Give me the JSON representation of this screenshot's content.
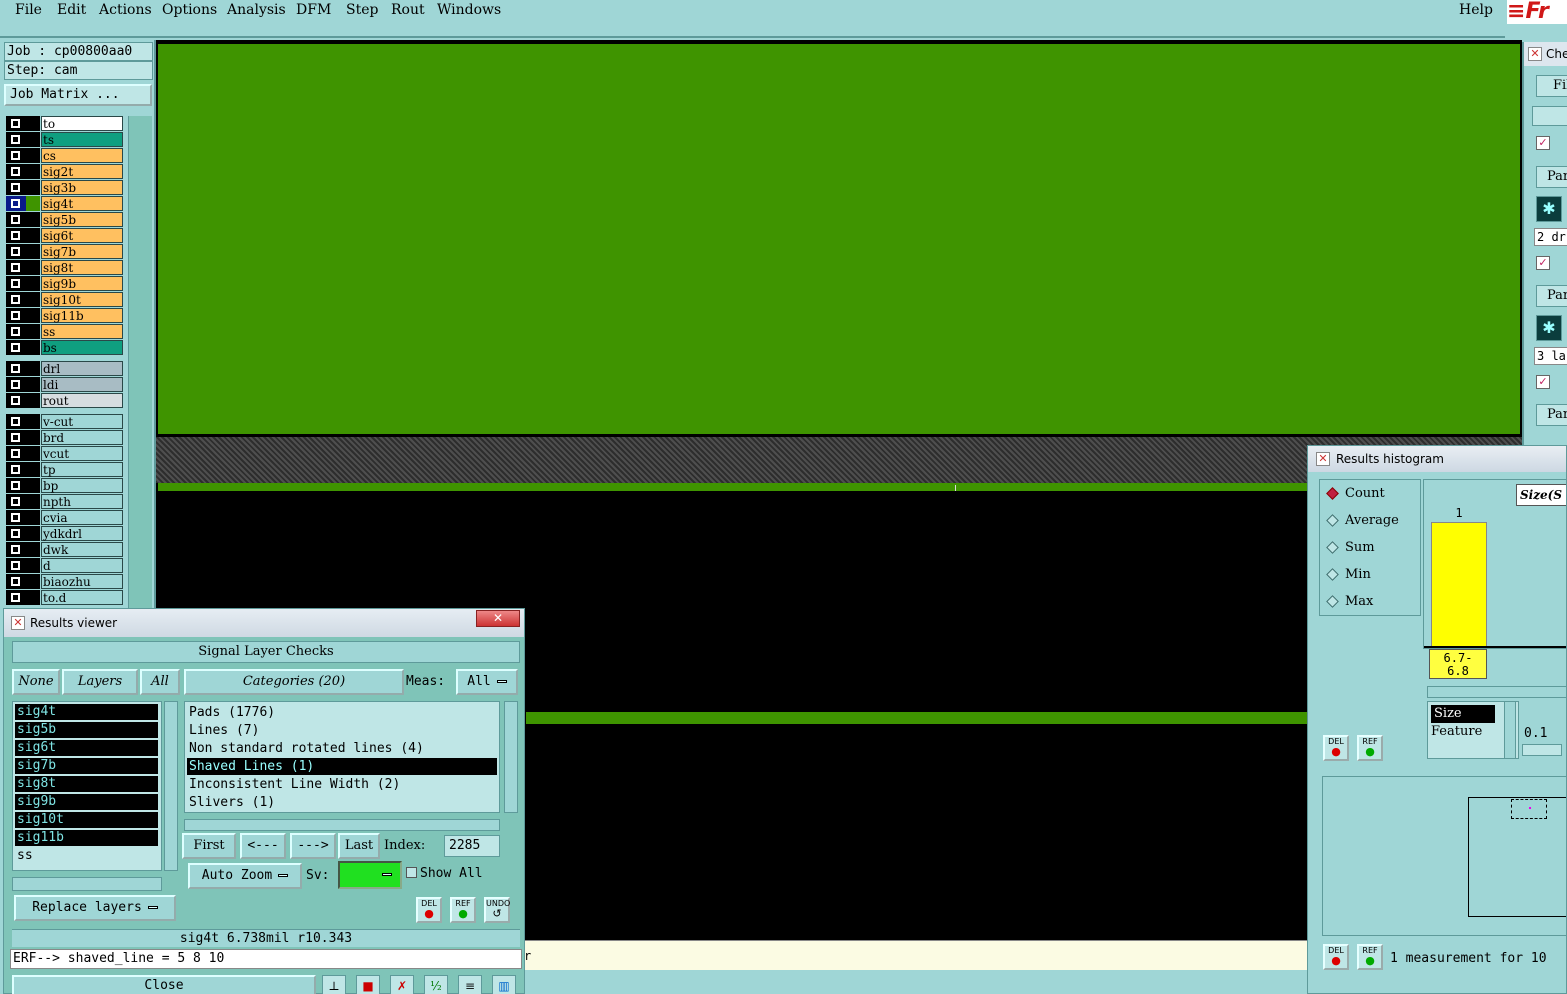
{
  "menu": {
    "items": [
      "File",
      "Edit",
      "Actions",
      "Options",
      "Analysis",
      "DFM",
      "Step",
      "Rout",
      "Windows"
    ],
    "help": "Help",
    "logo": "Fr"
  },
  "left_panel": {
    "job": "Job : cp00800aa0",
    "step": "Step: cam",
    "job_matrix": "Job Matrix ...",
    "layers": [
      {
        "name": "to",
        "color": "#ffffff"
      },
      {
        "name": "ts",
        "color": "#0f9f80"
      },
      {
        "name": "cs",
        "color": "#ffc060"
      },
      {
        "name": "sig2t",
        "color": "#ffc060"
      },
      {
        "name": "sig3b",
        "color": "#ffc060"
      },
      {
        "name": "sig4t",
        "color": "#ffc060"
      },
      {
        "name": "sig5b",
        "color": "#ffc060"
      },
      {
        "name": "sig6t",
        "color": "#ffc060"
      },
      {
        "name": "sig7b",
        "color": "#ffc060"
      },
      {
        "name": "sig8t",
        "color": "#ffc060"
      },
      {
        "name": "sig9b",
        "color": "#ffc060"
      },
      {
        "name": "sig10t",
        "color": "#ffc060"
      },
      {
        "name": "sig11b",
        "color": "#ffc060"
      },
      {
        "name": "ss",
        "color": "#ffc060"
      },
      {
        "name": "bs",
        "color": "#0f9f80"
      },
      {
        "name": "drl",
        "color": "#a8bcc4"
      },
      {
        "name": "ldi",
        "color": "#a8bcc4"
      },
      {
        "name": "rout",
        "color": "#d6dde0"
      },
      {
        "name": "v-cut",
        "color": "#9fd6d6"
      },
      {
        "name": "brd",
        "color": "#9fd6d6"
      },
      {
        "name": "vcut",
        "color": "#9fd6d6"
      },
      {
        "name": "tp",
        "color": "#9fd6d6"
      },
      {
        "name": "bp",
        "color": "#9fd6d6"
      },
      {
        "name": "npth",
        "color": "#9fd6d6"
      },
      {
        "name": "cvia",
        "color": "#9fd6d6"
      },
      {
        "name": "ydkdrl",
        "color": "#9fd6d6"
      },
      {
        "name": "dwk",
        "color": "#9fd6d6"
      },
      {
        "name": "d",
        "color": "#9fd6d6"
      },
      {
        "name": "biaozhu",
        "color": "#9fd6d6"
      },
      {
        "name": "to.d",
        "color": "#9fd6d6"
      }
    ],
    "active_layer": "sig4t"
  },
  "colors": {
    "canvas_bg": "#000000",
    "copper": "#3f9400",
    "panel": "#9fd6d6"
  },
  "status_bar": {
    "text": "r"
  },
  "right_window": {
    "title": "Che",
    "file_button": "File",
    "par_label": "Par",
    "entries": [
      "2 dr",
      "3 la"
    ]
  },
  "histogram": {
    "title": "Results histogram",
    "stats": [
      "Count",
      "Average",
      "Sum",
      "Min",
      "Max"
    ],
    "selected_stat": "Count",
    "size_combo": "Size(S",
    "bar_count": "1",
    "bar_label": "6.7-\n6.8",
    "list_items": [
      "Size",
      "Feature"
    ],
    "scale_value": "0.1",
    "del": "DEL",
    "ref": "REF",
    "measurement_text": "1 measurement for 10"
  },
  "results_viewer": {
    "title": "Results viewer",
    "heading": "Signal Layer Checks",
    "none_btn": "None",
    "layers_btn": "Layers",
    "all_btn": "All",
    "categories_btn": "Categories (20)",
    "meas_label": "Meas:",
    "meas_value": "All",
    "layer_items": [
      {
        "name": "sig4t",
        "selected": true
      },
      {
        "name": "sig5b",
        "selected": true
      },
      {
        "name": "sig6t",
        "selected": true
      },
      {
        "name": "sig7b",
        "selected": true
      },
      {
        "name": "sig8t",
        "selected": true
      },
      {
        "name": "sig9b",
        "selected": true
      },
      {
        "name": "sig10t",
        "selected": true
      },
      {
        "name": "sig11b",
        "selected": true
      },
      {
        "name": "ss",
        "selected": false
      }
    ],
    "categories": [
      {
        "name": "Pads (1776)",
        "selected": false
      },
      {
        "name": "Lines (7)",
        "selected": false
      },
      {
        "name": "Non standard rotated lines (4)",
        "selected": false
      },
      {
        "name": "Shaved Lines (1)",
        "selected": true
      },
      {
        "name": "Inconsistent Line Width (2)",
        "selected": false
      },
      {
        "name": "Slivers (1)",
        "selected": false
      }
    ],
    "nav": {
      "first": "First",
      "prev": "<---",
      "next": "--->",
      "last": "Last",
      "index_label": "Index:",
      "index_value": "2285"
    },
    "auto_zoom": "Auto Zoom",
    "sv_label": "Sv:",
    "show_all": "Show All",
    "replace_layers": "Replace layers",
    "del": "DEL",
    "ref": "REF",
    "undo": "UNDO",
    "info_line": "sig4t 6.738mil  r10.343",
    "erf_line": "ERF--> shaved_line = 5 8 10",
    "close": "Close"
  }
}
